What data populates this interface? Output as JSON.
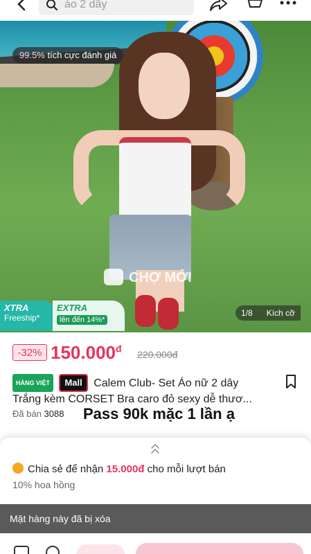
{
  "search": {
    "placeholder": "áo 2 dây"
  },
  "hero": {
    "rating_percent": "99.5%",
    "rating_text": " tích cực đánh giá",
    "watermark": "CHỢ MỚI",
    "freeship_title": "XTRA",
    "freeship_sub": "Freeship*",
    "extra_title": "EXTRA",
    "extra_sub": "lên đến 14%*",
    "image_counter": "1/8",
    "size_label": "Kích cỡ"
  },
  "product": {
    "discount": "-32%",
    "price": "150.000",
    "currency": "đ",
    "old_price": "220.000đ",
    "badge_vn": "HÀNG VIỆT",
    "badge_mall": "Mall",
    "title_line1": "Calem Club- Set Áo nữ 2 dây",
    "title_line2": "Trắng kèm CORSET Bra caro đỏ sexy dễ thươ...",
    "sold_label": "Đã bán",
    "sold_count": "3088",
    "overlay_text": "Pass 90k mặc 1 lần ạ"
  },
  "sheet": {
    "share_text": "Chia sẻ để nhận",
    "share_amount": "15.000đ",
    "share_suffix": "cho mỗi lượt bán",
    "commission": "10% hoa hồng"
  },
  "notice": {
    "deleted": "Mặt hàng này đã bị xóa"
  },
  "colors": {
    "accent": "#e8335a",
    "teal": "#25b7a7",
    "green": "#1aa35a"
  }
}
